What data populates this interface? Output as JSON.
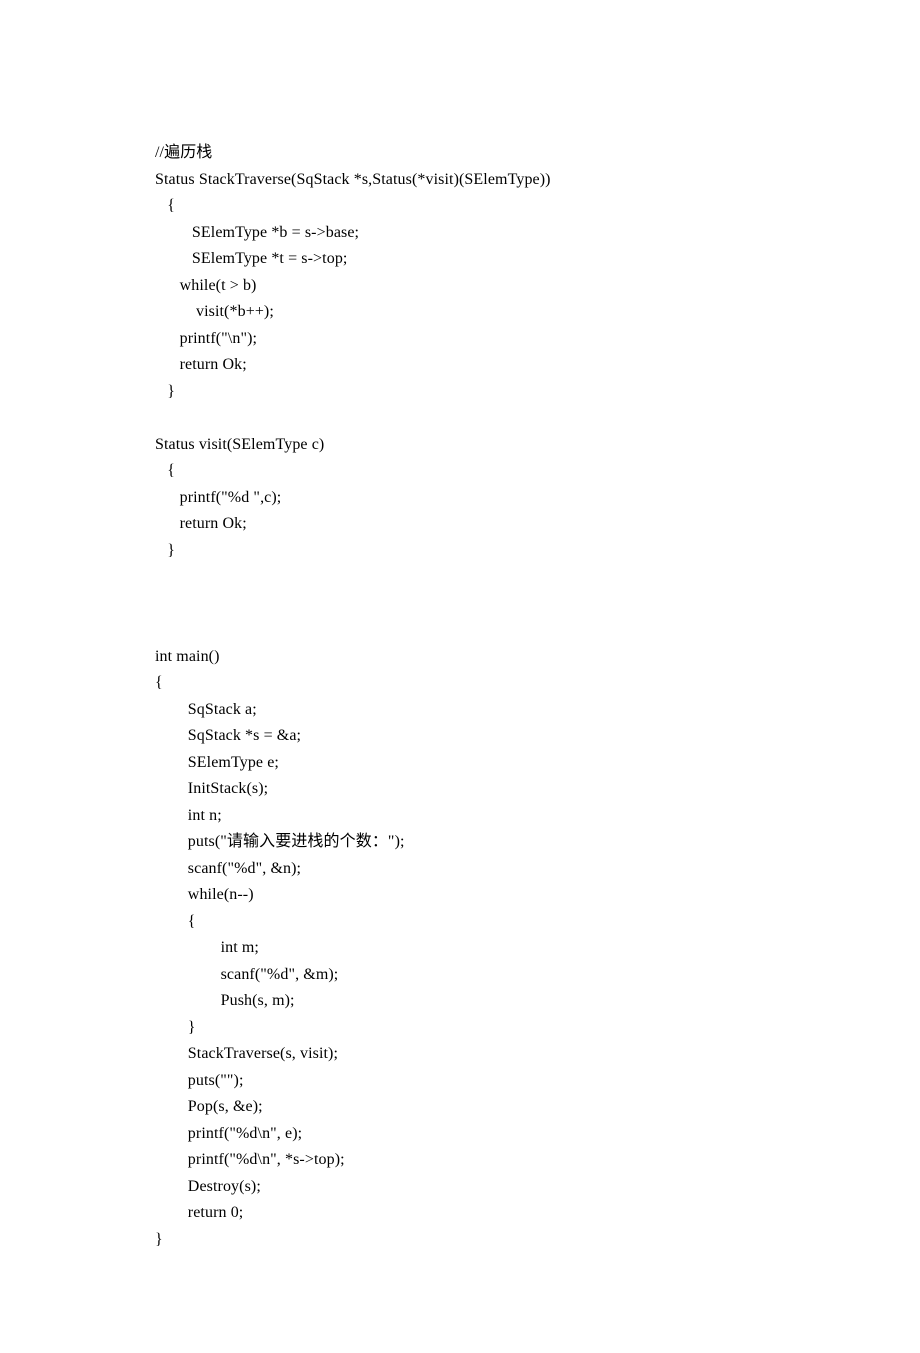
{
  "code": {
    "lines": [
      "//遍历栈",
      "Status StackTraverse(SqStack *s,Status(*visit)(SElemType))",
      "   {",
      "         SElemType *b = s->base;",
      "         SElemType *t = s->top;",
      "      while(t > b)",
      "          visit(*b++);",
      "      printf(\"\\n\");",
      "      return Ok;",
      "   }",
      "",
      "Status visit(SElemType c)",
      "   {",
      "      printf(\"%d \",c);",
      "      return Ok;",
      "   }",
      "",
      "",
      "",
      "int main()",
      "{",
      "        SqStack a;",
      "        SqStack *s = &a;",
      "        SElemType e;",
      "        InitStack(s);",
      "        int n;",
      "        puts(\"请输入要进栈的个数：\");",
      "        scanf(\"%d\", &n);",
      "        while(n--)",
      "        {",
      "                int m;",
      "                scanf(\"%d\", &m);",
      "                Push(s, m);",
      "        }",
      "        StackTraverse(s, visit);",
      "        puts(\"\");",
      "        Pop(s, &e);",
      "        printf(\"%d\\n\", e);",
      "        printf(\"%d\\n\", *s->top);",
      "        Destroy(s);",
      "        return 0;",
      "}"
    ]
  }
}
